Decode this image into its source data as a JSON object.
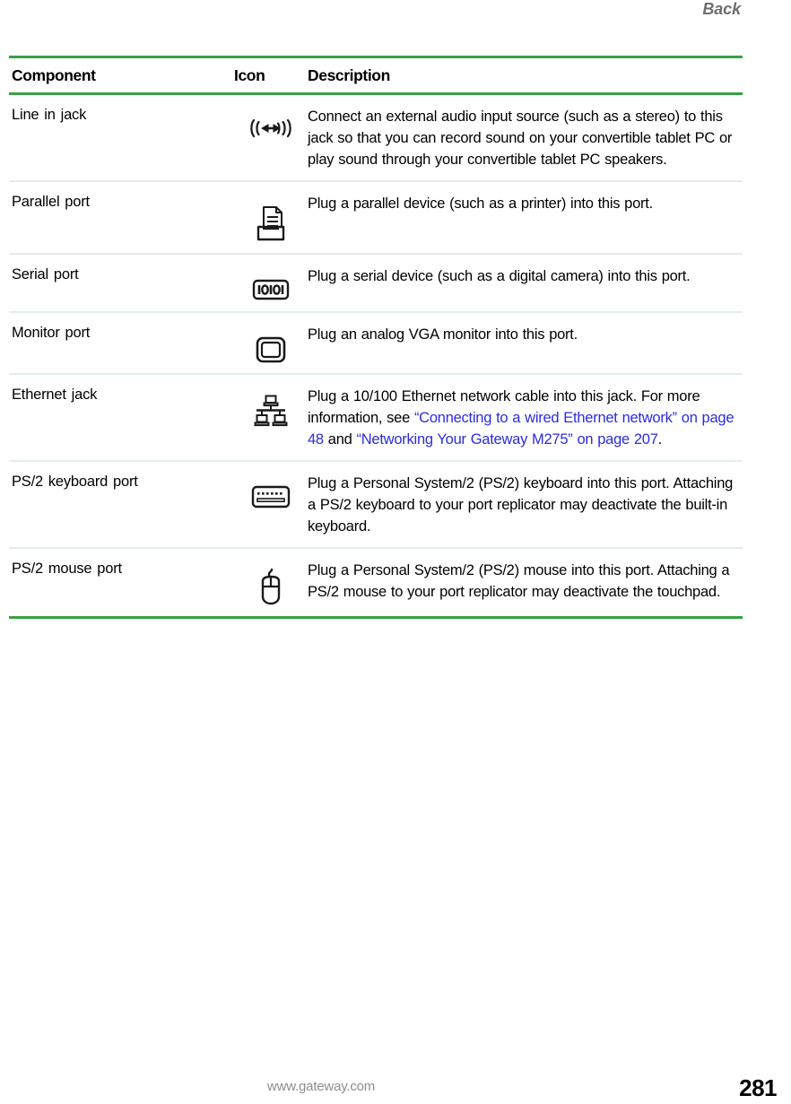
{
  "header": {
    "running_head": "Back"
  },
  "table": {
    "columns": [
      "Component",
      "Icon",
      "Description"
    ],
    "rows": [
      {
        "component": "Line in jack",
        "icon": "line-in-audio-icon",
        "description": "Connect an external audio input source (such as a stereo) to this jack so that you can record sound on your convertible tablet PC or play sound through your convertible tablet PC speakers."
      },
      {
        "component": "Parallel port",
        "icon": "printer-icon",
        "description": "Plug a parallel device (such as a printer) into this port."
      },
      {
        "component": "Serial port",
        "icon": "serial-port-icon",
        "description": "Plug a serial device (such as a digital camera) into this port."
      },
      {
        "component": "Monitor port",
        "icon": "monitor-icon",
        "description": "Plug an analog VGA monitor into this port."
      },
      {
        "component": "Ethernet jack",
        "icon": "network-icon",
        "description_parts": {
          "lead": "Plug a 10/100 Ethernet network cable into this jack. For more information, see ",
          "link1": "“Connecting to a wired Ethernet network” on page 48",
          "mid": " and ",
          "link2": "“Networking Your Gateway M275” on page 207",
          "tail": "."
        }
      },
      {
        "component": "PS/2 keyboard port",
        "icon": "keyboard-icon",
        "description": "Plug a Personal System/2 (PS/2) keyboard into this port. Attaching a PS/2 keyboard to your port replicator may deactivate the built-in keyboard."
      },
      {
        "component": "PS/2 mouse port",
        "icon": "mouse-icon",
        "description": "Plug a Personal System/2 (PS/2) mouse into this port. Attaching a PS/2 mouse to your port replicator may deactivate the touchpad."
      }
    ]
  },
  "footer": {
    "url": "www.gateway.com",
    "page_number": "281"
  },
  "colors": {
    "rule_green": "#37a144",
    "rule_light": "#e3efe3",
    "link_blue": "#2b2be0",
    "header_gray": "#6e6e6e",
    "footer_gray": "#8d8d8d"
  }
}
